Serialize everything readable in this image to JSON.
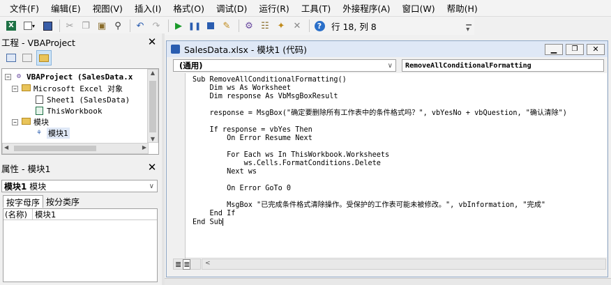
{
  "menu": [
    "文件(F)",
    "编辑(E)",
    "视图(V)",
    "插入(I)",
    "格式(O)",
    "调试(D)",
    "运行(R)",
    "工具(T)",
    "外接程序(A)",
    "窗口(W)",
    "帮助(H)"
  ],
  "toolbar": {
    "position": "行 18, 列 8"
  },
  "project": {
    "title": "工程 - VBAProject",
    "root": "VBAProject (SalesData.x",
    "excel_folder": "Microsoft Excel 对象",
    "sheet1": "Sheet1 (SalesData)",
    "thisworkbook": "ThisWorkbook",
    "modules_folder": "模块",
    "module1": "模块1"
  },
  "properties": {
    "title": "属性 - 模块1",
    "object": "模块1",
    "object_type": "模块",
    "tab_alpha": "按字母序",
    "tab_cat": "按分类序",
    "prop_name": "(名称)",
    "prop_value": "模块1"
  },
  "codewin": {
    "title": "SalesData.xlsx - 模块1 (代码)",
    "object_combo": "(通用)",
    "proc_combo": "RemoveAllConditionalFormatting"
  },
  "code_lines": [
    "Sub RemoveAllConditionalFormatting()",
    "    Dim ws As Worksheet",
    "    Dim response As VbMsgBoxResult",
    "",
    "    response = MsgBox(\"确定要删除所有工作表中的条件格式吗？\", vbYesNo + vbQuestion, \"确认清除\")",
    "",
    "    If response = vbYes Then",
    "        On Error Resume Next",
    "",
    "        For Each ws In ThisWorkbook.Worksheets",
    "            ws.Cells.FormatConditions.Delete",
    "        Next ws",
    "",
    "        On Error GoTo 0",
    "",
    "        MsgBox \"已完成条件格式清除操作。受保护的工作表可能未被修改。\", vbInformation, \"完成\"",
    "    End If",
    "End Sub"
  ],
  "colors": {
    "keyword": "#00008b",
    "titlebar": "#dfe8f6"
  }
}
